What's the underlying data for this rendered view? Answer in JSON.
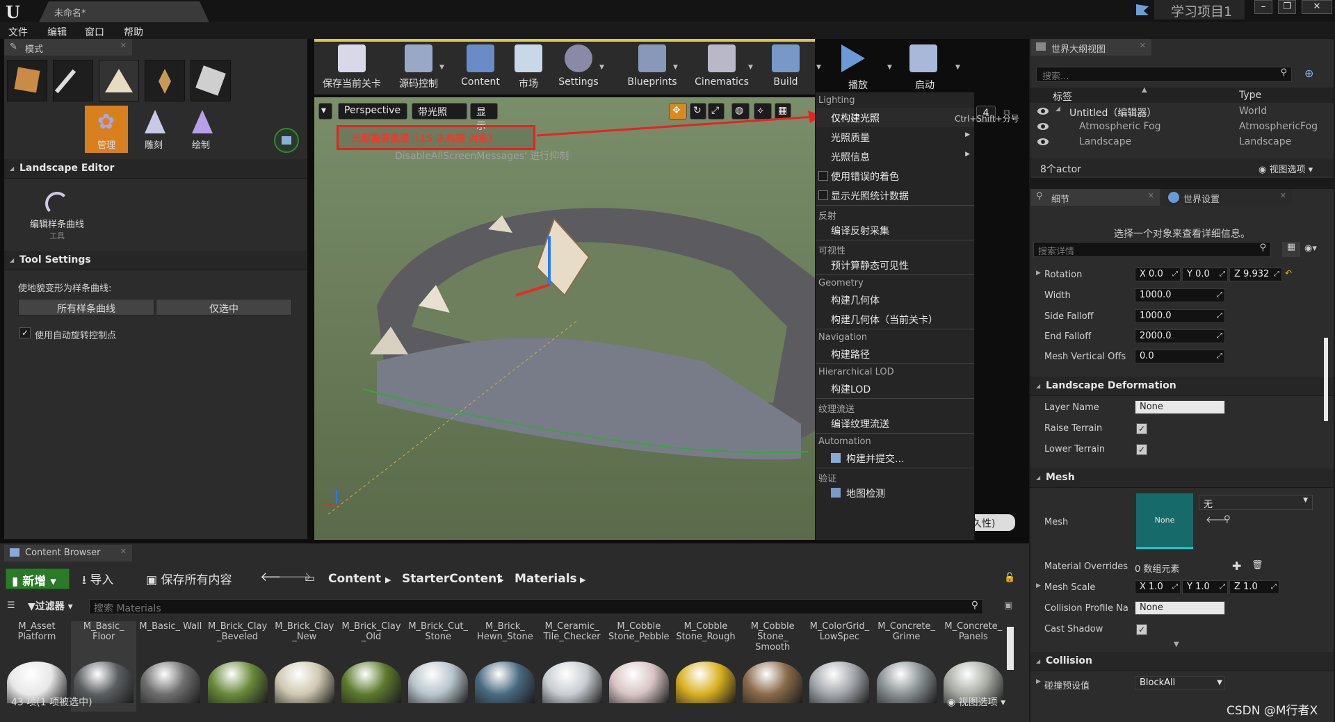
{
  "title_bar": {
    "doc_tab": "未命名*",
    "project": "学习项目1"
  },
  "menu": [
    "文件",
    "编辑",
    "窗口",
    "帮助"
  ],
  "modes_panel": {
    "tab": "模式",
    "tools": [
      "管理",
      "雕刻",
      "绘制"
    ],
    "landscape_editor": "Landscape Editor",
    "edit_spline_tool": "编辑样条曲线",
    "edit_spline_sub": "工具",
    "tool_settings": "Tool Settings",
    "deform_label": "使地貌变形为样条曲线:",
    "all_splines_btn": "所有样条曲线",
    "selected_only_btn": "仅选中",
    "auto_rotate_label": "使用自动旋转控制点"
  },
  "toolbar": {
    "buttons": [
      "保存当前关卡",
      "源码控制",
      "Content",
      "市场",
      "Settings",
      "Blueprints",
      "Cinematics",
      "Build",
      "播放",
      "启动"
    ]
  },
  "viewport": {
    "view_mode_btn": "Perspective",
    "lit_btn": "带光照",
    "show_btn": "显示",
    "camera_speed": "4",
    "warning": "光照需要重建（15 未构建 对象）",
    "suppress_msg": "DisableAllScreenMessages' 进行抑制",
    "bottom_right": "久性)"
  },
  "build_menu": {
    "sections": [
      {
        "category": "Lighting",
        "items": [
          {
            "label": "仅构建光照",
            "shortcut": "Ctrl+Shift+分号",
            "highlight": true
          },
          {
            "label": "光照质量",
            "submenu": true
          },
          {
            "label": "光照信息",
            "submenu": true
          },
          {
            "label": "使用错误的着色",
            "checkbox": true
          },
          {
            "label": "显示光照统计数据",
            "checkbox": true
          }
        ]
      },
      {
        "category": "反射",
        "items": [
          {
            "label": "编译反射采集"
          }
        ]
      },
      {
        "category": "可视性",
        "items": [
          {
            "label": "预计算静态可见性"
          }
        ]
      },
      {
        "category": "Geometry",
        "items": [
          {
            "label": "构建几何体"
          },
          {
            "label": "构建几何体（当前关卡）"
          }
        ]
      },
      {
        "category": "Navigation",
        "items": [
          {
            "label": "构建路径"
          }
        ]
      },
      {
        "category": "Hierarchical LOD",
        "items": [
          {
            "label": "构建LOD"
          }
        ]
      },
      {
        "category": "纹理流送",
        "items": [
          {
            "label": "编译纹理流送"
          }
        ]
      },
      {
        "category": "Automation",
        "items": [
          {
            "label": "构建并提交..."
          }
        ]
      },
      {
        "category": "验证",
        "items": [
          {
            "label": "地图检测"
          }
        ]
      }
    ]
  },
  "outliner": {
    "tab": "世界大纲视图",
    "search_placeholder": "搜索...",
    "col_label": "标签",
    "col_type": "Type",
    "rows": [
      {
        "label": "Untitled（编辑器）",
        "type": "World"
      },
      {
        "label": "Atmospheric Fog",
        "type": "AtmosphericFog"
      },
      {
        "label": "Landscape",
        "type": "Landscape"
      }
    ],
    "actor_count": "8个actor",
    "view_options": "视图选项"
  },
  "details": {
    "tab": "细节",
    "tab2": "世界设置",
    "hint": "选择一个对象来查看详细信息。",
    "search_placeholder": "搜索详情",
    "rotation": {
      "label": "Rotation",
      "x": "X  0.0",
      "y": "Y  0.0",
      "z": "Z  9.932"
    },
    "width": {
      "label": "Width",
      "value": "1000.0"
    },
    "side_falloff": {
      "label": "Side Falloff",
      "value": "1000.0"
    },
    "end_falloff": {
      "label": "End Falloff",
      "value": "2000.0"
    },
    "mesh_vertical_offset": {
      "label": "Mesh Vertical Offs",
      "value": "0.0"
    },
    "deformation_hdr": "Landscape Deformation",
    "layer_name": {
      "label": "Layer Name",
      "value": "None"
    },
    "raise_terrain": "Raise Terrain",
    "lower_terrain": "Lower Terrain",
    "mesh_hdr": "Mesh",
    "mesh_label": "Mesh",
    "mesh_thumb": "None",
    "mesh_combo": "无",
    "material_overrides": {
      "label": "Material Overrides",
      "value": "0 数组元素"
    },
    "mesh_scale": {
      "label": "Mesh Scale",
      "x": "X  1.0",
      "y": "Y  1.0",
      "z": "Z  1.0"
    },
    "collision_profile": {
      "label": "Collision Profile Na",
      "value": "None"
    },
    "cast_shadow": "Cast Shadow",
    "collision_hdr": "Collision",
    "collision_preset": {
      "label": "碰撞预设值",
      "value": "BlockAll"
    }
  },
  "content_browser": {
    "tab": "Content Browser",
    "add_new": "新增",
    "import": "导入",
    "save_all": "保存所有内容",
    "breadcrumbs": [
      "Content",
      "StarterContent",
      "Materials"
    ],
    "filters": "过滤器",
    "search_placeholder": "搜索 Materials",
    "assets": [
      {
        "name": "M_Asset Platform",
        "color": "#e8e8e8"
      },
      {
        "name": "M_Basic_ Floor",
        "color": "#5a5e60"
      },
      {
        "name": "M_Basic_ Wall",
        "color": "#6e6e6e"
      },
      {
        "name": "M_Brick_Clay _Beveled",
        "color": "#6a8a3a"
      },
      {
        "name": "M_Brick_Clay _New",
        "color": "#cfc8b2"
      },
      {
        "name": "M_Brick_Clay _Old",
        "color": "#5e7a2e"
      },
      {
        "name": "M_Brick_Cut_ Stone",
        "color": "#b8c4cc"
      },
      {
        "name": "M_Brick_ Hewn_Stone",
        "color": "#4a6a80"
      },
      {
        "name": "M_Ceramic_ Tile_Checker",
        "color": "#c8cdd2"
      },
      {
        "name": "M_Cobble Stone_Pebble",
        "color": "#d8c4c4"
      },
      {
        "name": "M_Cobble Stone_Rough",
        "color": "#d8b020"
      },
      {
        "name": "M_Cobble Stone_ Smooth",
        "color": "#8a6a4a"
      },
      {
        "name": "M_ColorGrid_ LowSpec",
        "color": "#a4a8ac"
      },
      {
        "name": "M_Concrete_ Grime",
        "color": "#8a9294"
      },
      {
        "name": "M_Concrete_ Panels",
        "color": "#a8aca4"
      }
    ],
    "status": "43 项(1 项被选中)",
    "view_options": "视图选项"
  },
  "watermark": "CSDN @M行者X"
}
